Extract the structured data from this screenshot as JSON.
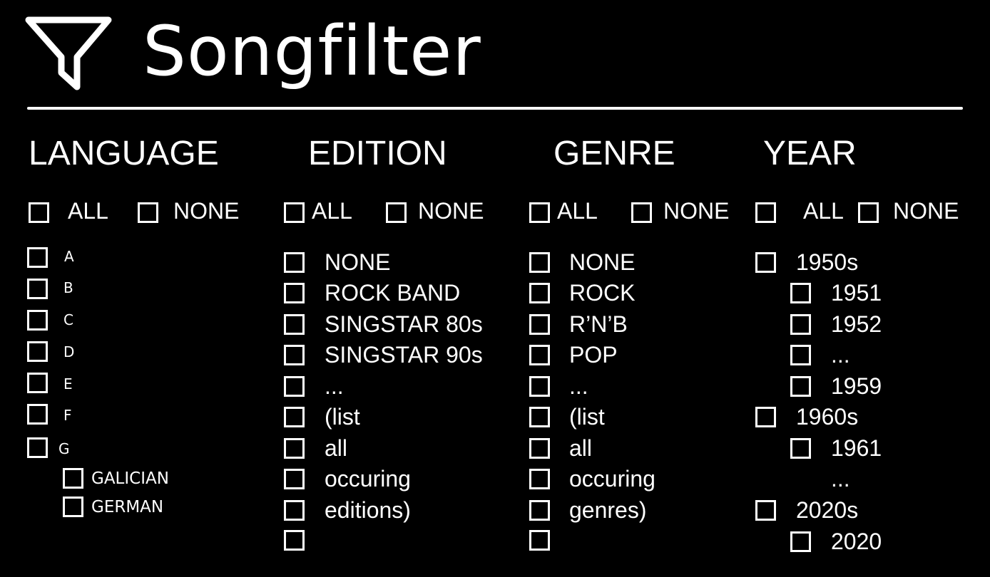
{
  "app": {
    "title": "Songfilter"
  },
  "language": {
    "heading": "LANGUAGE",
    "all_label": "ALL",
    "none_label": "NONE",
    "letters": [
      "A",
      "B",
      "C",
      "D",
      "E",
      "F",
      "G"
    ],
    "g_children": [
      "GALICIAN",
      "GERMAN"
    ]
  },
  "edition": {
    "heading": "EDITION",
    "all_label": "ALL",
    "none_label": "NONE",
    "items": [
      "NONE",
      "ROCK BAND",
      "SINGSTAR 80s",
      "SINGSTAR 90s",
      "...",
      "(list",
      "all",
      "occuring",
      "editions)",
      ""
    ]
  },
  "genre": {
    "heading": "GENRE",
    "all_label": "ALL",
    "none_label": "NONE",
    "items": [
      "NONE",
      "ROCK",
      "R’N’B",
      "POP",
      "...",
      "(list",
      "all",
      "occuring",
      "genres)",
      ""
    ]
  },
  "year": {
    "heading": "YEAR",
    "all_label": "ALL",
    "none_label": "NONE",
    "decade_1950s": "1950s",
    "y1951": "1951",
    "y1952": "1952",
    "ellipsis_1950s": "...",
    "y1959": "1959",
    "decade_1960s": "1960s",
    "y1961": "1961",
    "ellipsis_between": "...",
    "decade_2020s": "2020s",
    "y2020": "2020"
  }
}
